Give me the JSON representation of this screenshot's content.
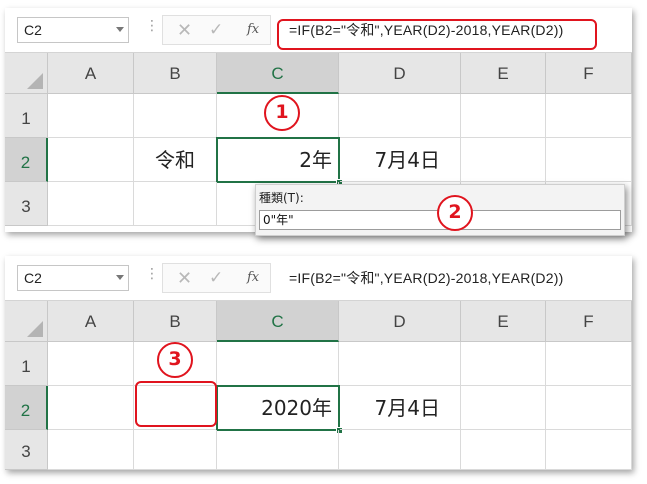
{
  "top": {
    "namebox": "C2",
    "formula": "=IF(B2=\"令和\",YEAR(D2)-2018,YEAR(D2))",
    "columns": [
      "A",
      "B",
      "C",
      "D",
      "E",
      "F"
    ],
    "rows": [
      "1",
      "2",
      "3"
    ],
    "cells": {
      "B2": "令和",
      "C2": "2年",
      "D2": "7月4日"
    },
    "badge1": "1"
  },
  "dialog": {
    "label": "種類(T):",
    "value": "0\"年\"",
    "badge2": "2"
  },
  "bottom": {
    "namebox": "C2",
    "formula": "=IF(B2=\"令和\",YEAR(D2)-2018,YEAR(D2))",
    "columns": [
      "A",
      "B",
      "C",
      "D",
      "E",
      "F"
    ],
    "rows": [
      "1",
      "2",
      "3"
    ],
    "cells": {
      "B2": "",
      "C2": "2020年",
      "D2": "7月4日"
    },
    "badge3": "3"
  },
  "toolbar": {
    "cancel_icon": "✕",
    "enter_icon": "✓",
    "fx_icon": "fx",
    "separator": "⋮"
  },
  "colors": {
    "accent_green": "#217346",
    "annotation_red": "#e0141e"
  }
}
